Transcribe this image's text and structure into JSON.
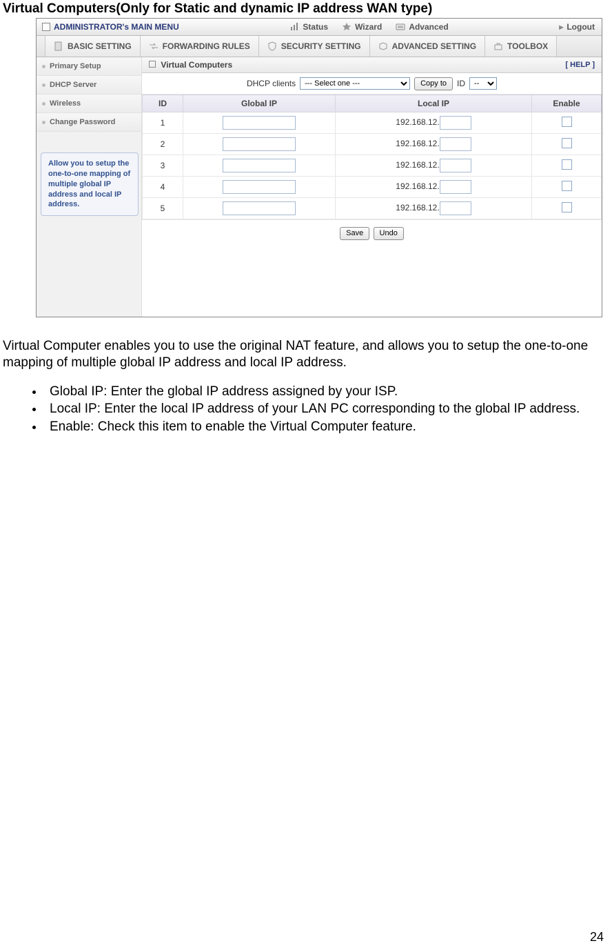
{
  "page": {
    "heading": "Virtual Computers(Only for Static and dynamic IP address WAN type)",
    "paragraph": "Virtual Computer enables you to use the original NAT feature, and allows you to setup the one-to-one mapping of multiple global IP address and local IP address.",
    "bullets": [
      "Global IP: Enter the global IP address assigned by your ISP.",
      "Local IP: Enter the local IP address of your LAN PC corresponding to the global IP address.",
      "Enable: Check this item to enable the Virtual Computer feature."
    ],
    "pagenum": "24"
  },
  "topbar": {
    "title": "ADMINISTRATOR's MAIN MENU",
    "items": [
      "Status",
      "Wizard",
      "Advanced"
    ],
    "logout": "Logout"
  },
  "tabs": [
    "BASIC SETTING",
    "FORWARDING RULES",
    "SECURITY SETTING",
    "ADVANCED SETTING",
    "TOOLBOX"
  ],
  "sidebar": {
    "items": [
      "Primary Setup",
      "DHCP Server",
      "Wireless",
      "Change Password"
    ],
    "help": "Allow you to setup the one-to-one mapping of multiple global IP address and local IP address."
  },
  "panel": {
    "title": "Virtual Computers",
    "help": "[ HELP ]",
    "dhcp_label": "DHCP clients",
    "dhcp_select": "--- Select one ---",
    "copy_btn": "Copy to",
    "id_label": "ID",
    "id_select": "--",
    "cols": [
      "ID",
      "Global IP",
      "Local IP",
      "Enable"
    ],
    "rows": [
      {
        "id": "1",
        "local_prefix": "192.168.12."
      },
      {
        "id": "2",
        "local_prefix": "192.168.12."
      },
      {
        "id": "3",
        "local_prefix": "192.168.12."
      },
      {
        "id": "4",
        "local_prefix": "192.168.12."
      },
      {
        "id": "5",
        "local_prefix": "192.168.12."
      }
    ],
    "save": "Save",
    "undo": "Undo"
  }
}
